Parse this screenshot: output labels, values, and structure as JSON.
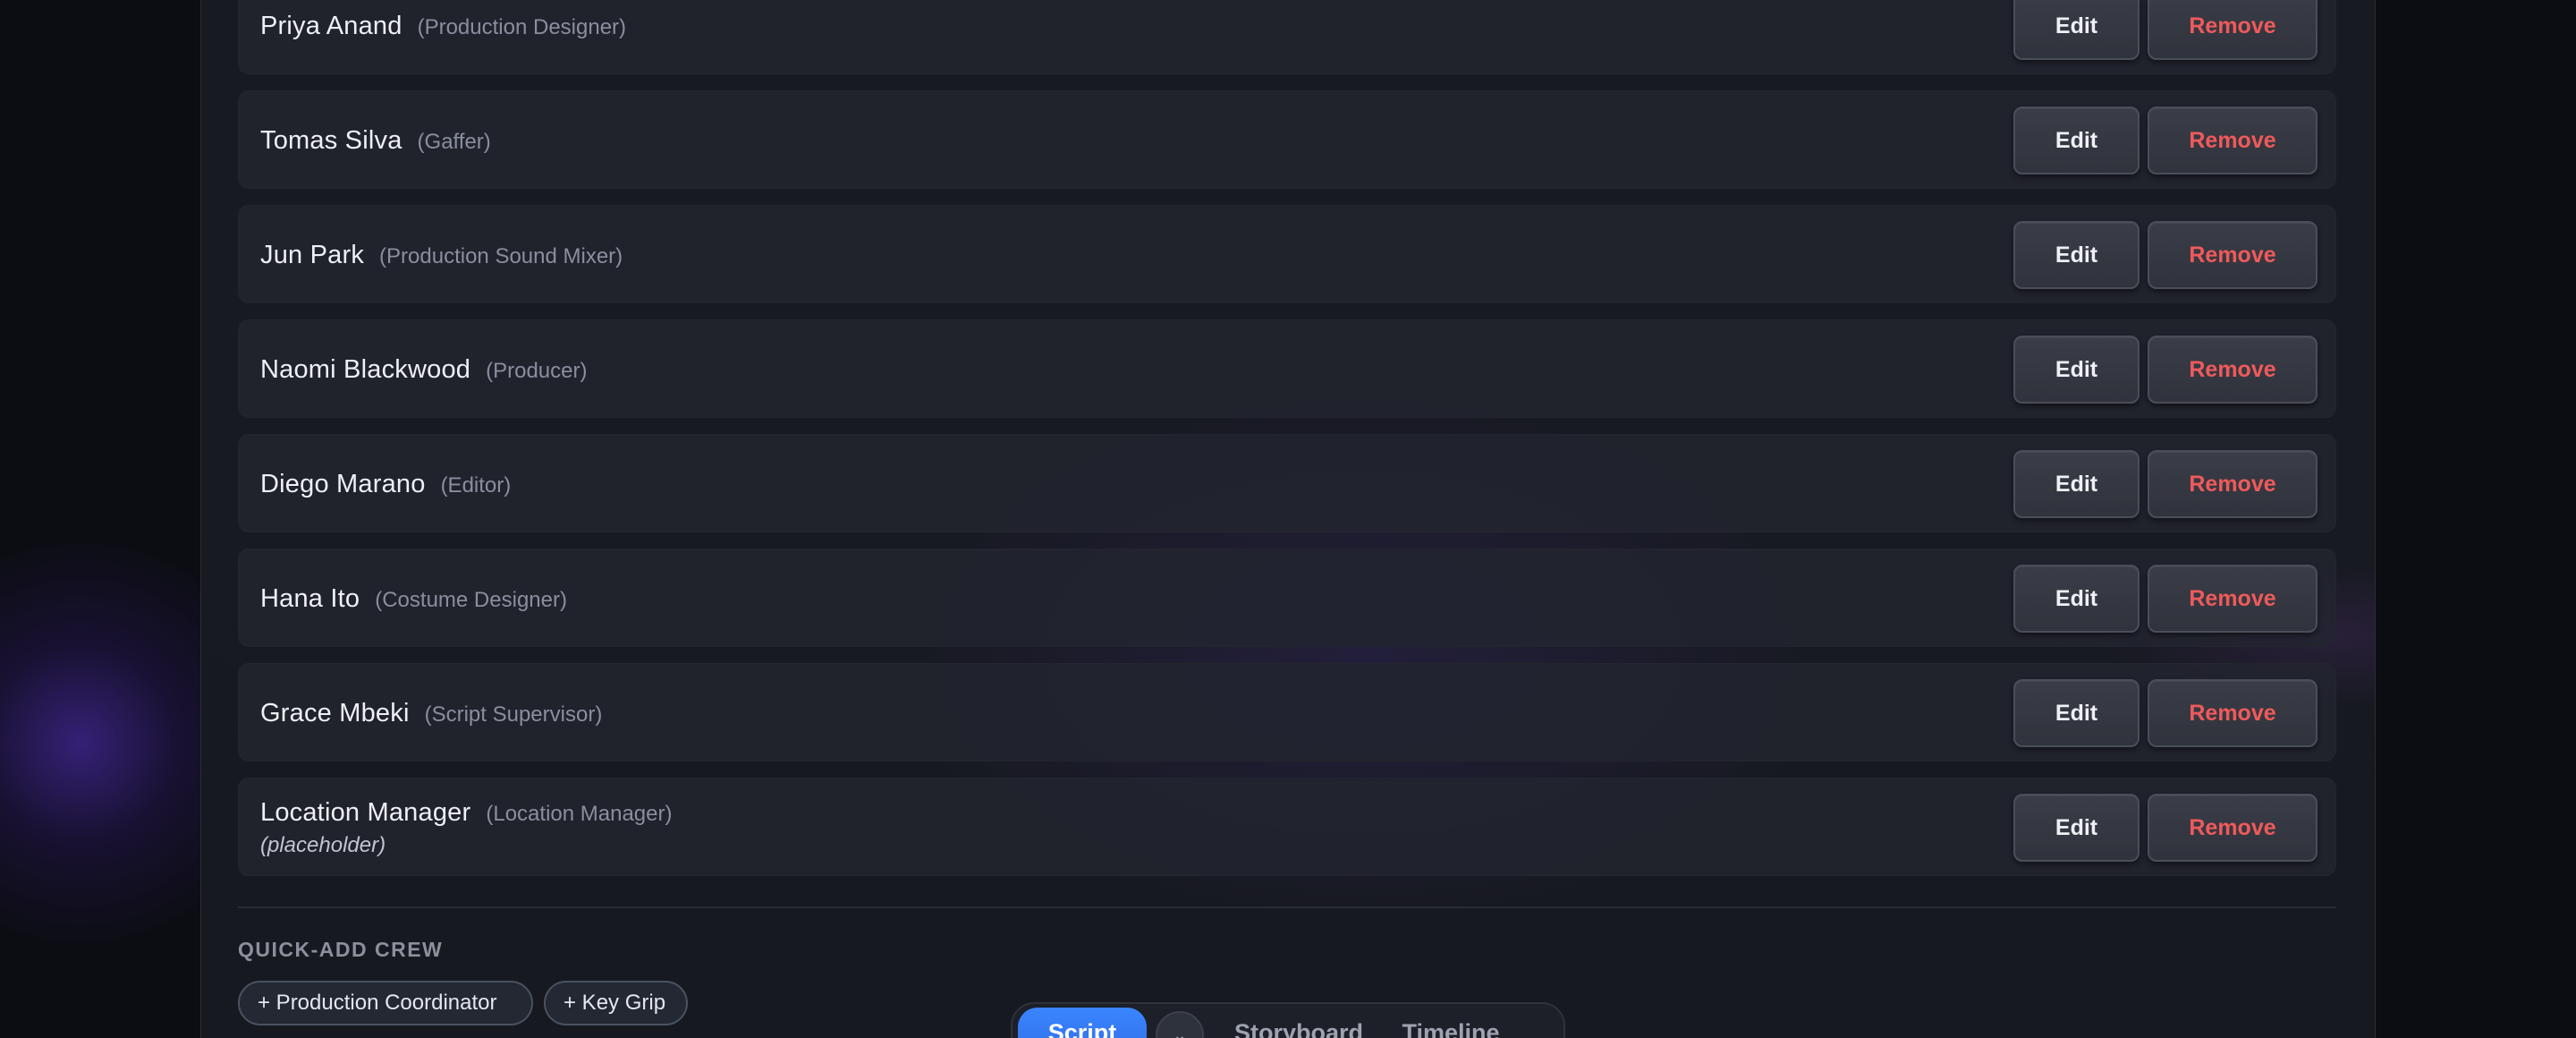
{
  "crew": [
    {
      "name": "Priya Anand",
      "role": "(Production Designer)",
      "note": ""
    },
    {
      "name": "Tomas Silva",
      "role": "(Gaffer)",
      "note": ""
    },
    {
      "name": "Jun Park",
      "role": "(Production Sound Mixer)",
      "note": ""
    },
    {
      "name": "Naomi Blackwood",
      "role": "(Producer)",
      "note": ""
    },
    {
      "name": "Diego Marano",
      "role": "(Editor)",
      "note": ""
    },
    {
      "name": "Hana Ito",
      "role": "(Costume Designer)",
      "note": ""
    },
    {
      "name": "Grace Mbeki",
      "role": "(Script Supervisor)",
      "note": ""
    },
    {
      "name": "Location Manager",
      "role": "(Location Manager)",
      "note": "(placeholder)"
    }
  ],
  "actions": {
    "edit_label": "Edit",
    "remove_label": "Remove"
  },
  "quick_add": {
    "title": "QUICK-ADD CREW",
    "chips": [
      "+ Production Coordinator",
      "+ Key Grip"
    ]
  },
  "tabs": {
    "active": "Script",
    "toggle_icon": "chevron-down-icon",
    "toggle_glyph": "⌄",
    "items": [
      "Storyboard",
      "Timeline"
    ]
  },
  "colors": {
    "accent": "#3a86ff",
    "danger": "#ef5a5a",
    "background": "#0c0d13",
    "panel": "#181a22"
  }
}
